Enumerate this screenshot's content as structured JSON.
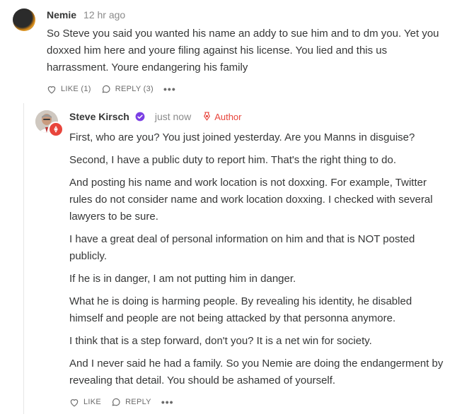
{
  "comment1": {
    "author": "Nemie",
    "time": "12 hr ago",
    "text": "So Steve you said you wanted his name an addy to sue him and to dm you. Yet you doxxed him here and youre filing against his license. You lied and this us harrassment. Youre endangering his family",
    "like_label": "LIKE (1)",
    "reply_label": "REPLY (3)",
    "more": "•••"
  },
  "comment2": {
    "author": "Steve Kirsch",
    "time": "just now",
    "author_badge": "Author",
    "paragraphs": [
      "First, who are you? You just joined yesterday. Are you Manns in disguise?",
      "Second, I have a public duty to report him. That's the right thing to do.",
      "And posting his name and work location is not doxxing. For example, Twitter rules do not consider name and work location doxxing. I checked with several lawyers to be sure.",
      "I have a great deal of personal information on him and that is NOT posted publicly.",
      "If he is in danger, I am not putting him in danger.",
      "What he is doing is harming people. By revealing his identity, he disabled himself and people are not being attacked by that personna anymore.",
      "I think that is a step forward, don't you? It is a net win for society.",
      "And I never said he had a family. So you Nemie are doing the endangerment by revealing that detail. You should be ashamed of yourself."
    ],
    "like_label": "LIKE",
    "reply_label": "REPLY",
    "more": "•••"
  },
  "colors": {
    "accent": "#e8453c",
    "verified": "#7b3fe4",
    "muted": "#8a8a8a"
  }
}
